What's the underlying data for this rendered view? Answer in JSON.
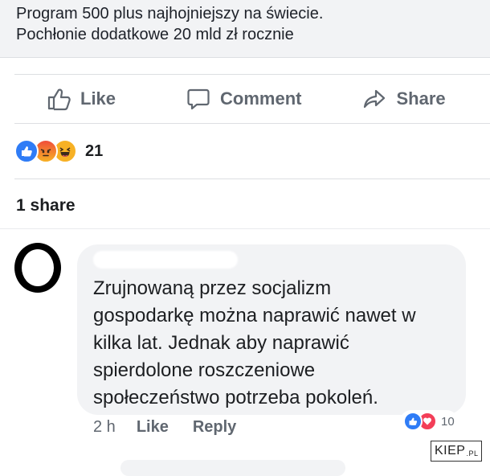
{
  "link_preview": {
    "line1": "Program 500 plus najhojniejszy na świecie.",
    "line2": "Pochłonie dodatkowe 20 mld zł rocznie"
  },
  "actions": {
    "like_label": "Like",
    "comment_label": "Comment",
    "share_label": "Share"
  },
  "reactions": {
    "types": [
      "like",
      "angry",
      "haha"
    ],
    "count": "21"
  },
  "shares": {
    "label": "1 share"
  },
  "comment": {
    "lines": [
      "Zrujnowaną przez socjalizm",
      "gospodarkę można naprawić nawet w",
      "kilka lat. Jednak aby naprawić",
      "spierdolone roszczeniowe",
      "społeczeństwo potrzeba pokoleń."
    ],
    "time": "2 h",
    "like_label": "Like",
    "reply_label": "Reply",
    "reaction_types": [
      "like",
      "love"
    ],
    "reaction_count": "10"
  },
  "watermark": {
    "main": "KIEP",
    "suffix": ".PL"
  },
  "colors": {
    "facebook_blue": "#2f7cf6",
    "love_red": "#f33e58",
    "muted_text": "#606770",
    "bubble_bg": "#f2f3f5"
  }
}
